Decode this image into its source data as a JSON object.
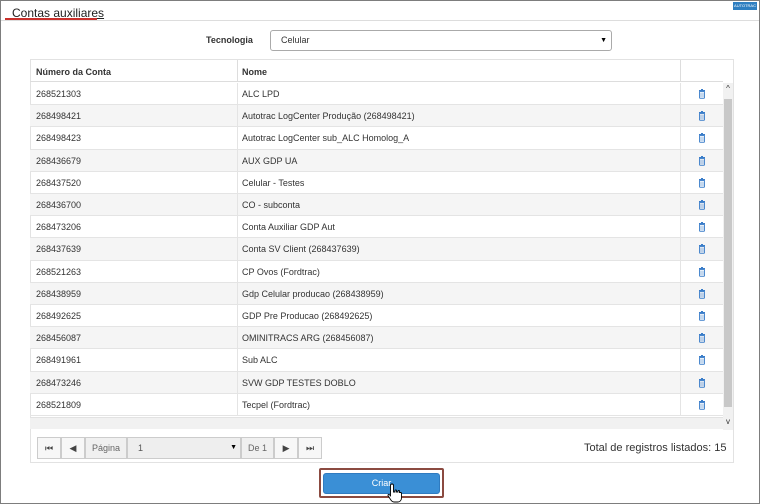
{
  "header": {
    "title": "Contas auxiliares",
    "badge": "AUTOTRAC"
  },
  "filter": {
    "label": "Tecnologia",
    "selected": "Celular"
  },
  "table": {
    "columns": [
      "Número da Conta",
      "Nome"
    ],
    "rows": [
      [
        "268521303",
        "ALC LPD"
      ],
      [
        "268498421",
        "Autotrac LogCenter Produção (268498421)"
      ],
      [
        "268498423",
        "Autotrac LogCenter sub_ALC Homolog_A"
      ],
      [
        "268436679",
        "AUX GDP UA"
      ],
      [
        "268437520",
        "Celular - Testes"
      ],
      [
        "268436700",
        "CO - subconta"
      ],
      [
        "268473206",
        "Conta Auxiliar GDP Aut"
      ],
      [
        "268437639",
        "Conta SV Client (268437639)"
      ],
      [
        "268521263",
        "CP Ovos (Fordtrac)"
      ],
      [
        "268438959",
        "Gdp Celular producao (268438959)"
      ],
      [
        "268492625",
        "GDP Pre Producao (268492625)"
      ],
      [
        "268456087",
        "OMINITRACS ARG (268456087)"
      ],
      [
        "268491961",
        "Sub ALC"
      ],
      [
        "268473246",
        "SVW GDP TESTES DOBLO"
      ],
      [
        "268521809",
        "Tecpel (Fordtrac)"
      ]
    ],
    "delete_icon": "trash-icon",
    "icon_color": "#3a7dc9"
  },
  "pagination": {
    "page_label": "Página",
    "page_value": "1",
    "of_label": "De 1",
    "first": "⏮",
    "prev": "◀",
    "next": "▶",
    "last": "⏭"
  },
  "total_text": "Total de registros listados: 15",
  "actions": {
    "create_label": "Criar",
    "create_color": "#3a8fd6"
  }
}
